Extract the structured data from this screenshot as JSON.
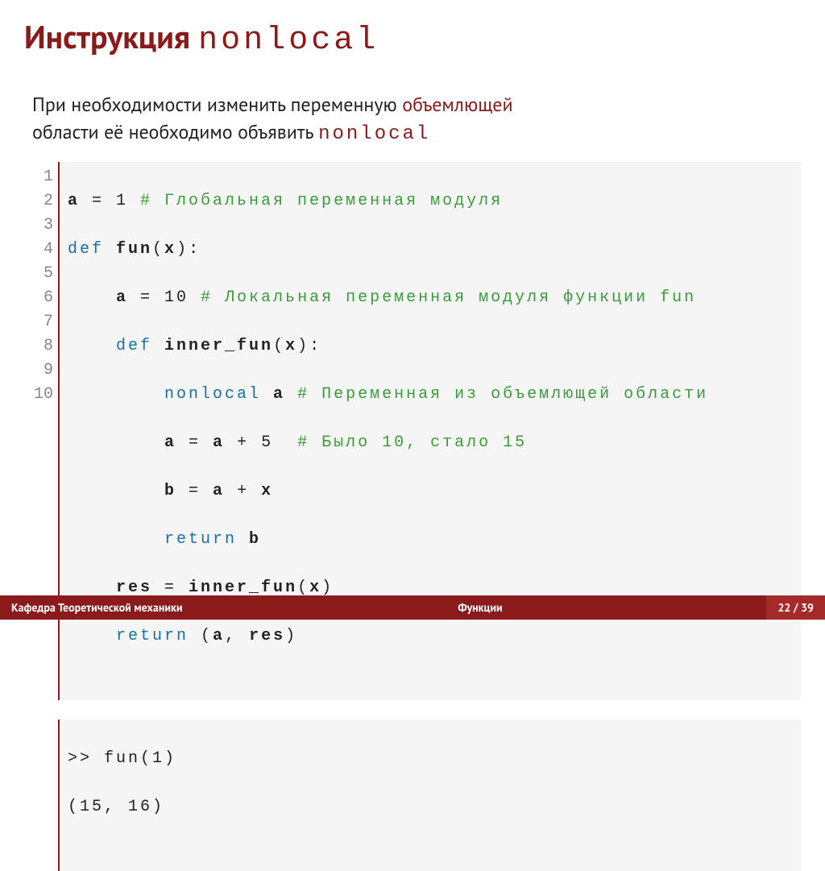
{
  "title": {
    "word": "Инструкция",
    "mono": "nonlocal"
  },
  "desc": {
    "p1a": "При необходимости изменить переменную ",
    "p1b": "объемлющей",
    "p2a": "области её необходимо объявить ",
    "p2b": "nonlocal"
  },
  "code": {
    "gutter": [
      "1",
      "2",
      "3",
      "4",
      "5",
      "6",
      "7",
      "8",
      "9",
      "10"
    ],
    "l1_a": "a",
    "l1_eq": " = 1 ",
    "l1_cm": "# Глобальная переменная модуля",
    "l2_kw": "def",
    "l2_fn": " fun",
    "l2_rest": "(",
    "l2_x": "x",
    "l2_end": "):",
    "l3_pad": "    ",
    "l3_a": "a",
    "l3_eq": " = 10 ",
    "l3_cm": "# Локальная переменная модуля функции fun",
    "l4_pad": "    ",
    "l4_kw": "def",
    "l4_fn": " inner_fun",
    "l4_rest": "(",
    "l4_x": "x",
    "l4_end": "):",
    "l5_pad": "        ",
    "l5_kw": "nonlocal",
    "l5_sp": " ",
    "l5_a": "a",
    "l5_sp2": " ",
    "l5_cm": "# Переменная из объемлющей области",
    "l6_pad": "        ",
    "l6_a": "a",
    "l6_eq": " = ",
    "l6_a2": "a",
    "l6_plus": " + 5  ",
    "l6_cm": "# Было 10, стало 15",
    "l7_pad": "        ",
    "l7_b": "b",
    "l7_eq": " = ",
    "l7_a": "a",
    "l7_plus": " + ",
    "l7_x": "x",
    "l8_pad": "        ",
    "l8_kw": "return",
    "l8_sp": " ",
    "l8_b": "b",
    "l9_pad": "    ",
    "l9_res": "res",
    "l9_eq": " = ",
    "l9_fn": "inner_fun",
    "l9_rest": "(",
    "l9_x": "x",
    "l9_end": ")",
    "l10_pad": "    ",
    "l10_kw": "return",
    "l10_rest": " (",
    "l10_a": "a",
    "l10_c": ", ",
    "l10_res": "res",
    "l10_end": ")"
  },
  "output": {
    "l1": ">> fun(1)",
    "l2": "(15, 16)"
  },
  "footer": {
    "left": "Кафедра Теоретической механики",
    "center": "Функции",
    "right": "22 / 39"
  }
}
